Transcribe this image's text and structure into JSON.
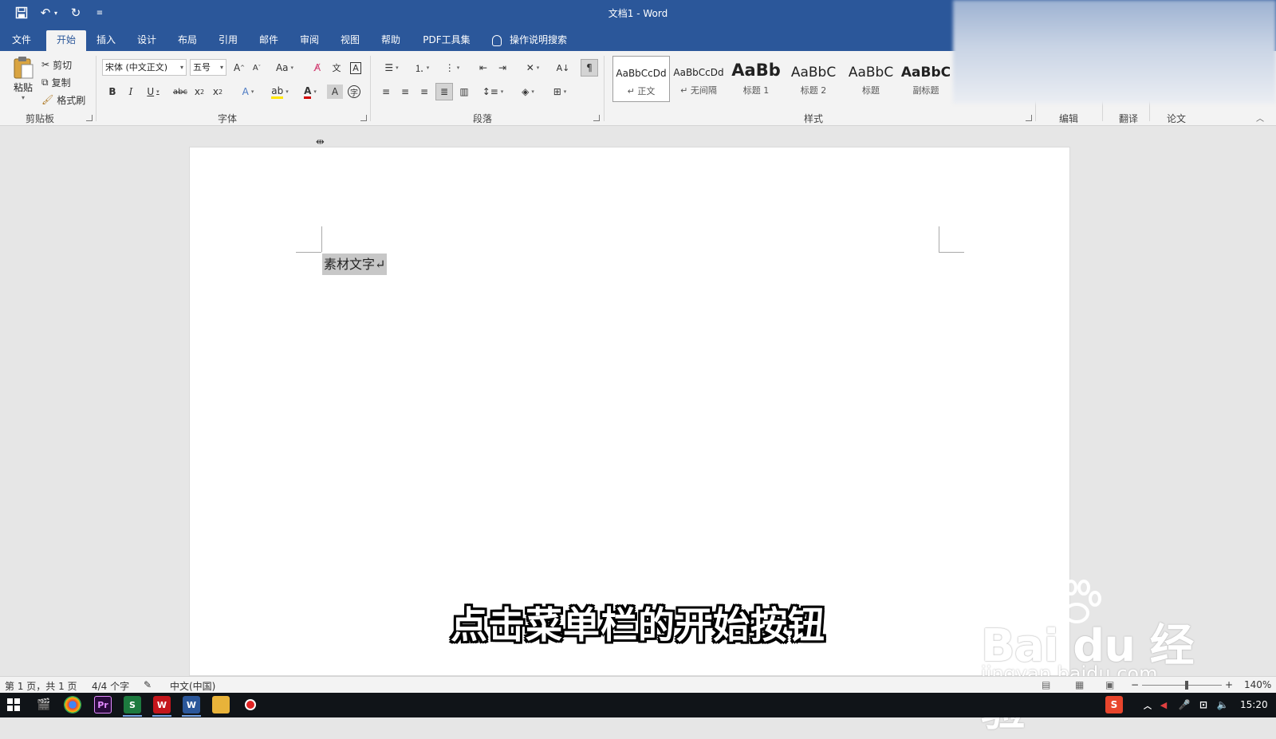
{
  "title_bar": {
    "document_title": "文档1  -  Word"
  },
  "menu": {
    "tabs": [
      "文件",
      "开始",
      "插入",
      "设计",
      "布局",
      "引用",
      "邮件",
      "审阅",
      "视图",
      "帮助",
      "PDF工具集"
    ],
    "active_tab": "开始",
    "tell_me": "操作说明搜索"
  },
  "ribbon": {
    "clipboard": {
      "label": "剪贴板",
      "paste": "粘贴",
      "cut": "剪切",
      "copy": "复制",
      "format_painter": "格式刷"
    },
    "font": {
      "label": "字体",
      "font_name": "宋体 (中文正文)",
      "font_size": "五号"
    },
    "paragraph": {
      "label": "段落"
    },
    "styles": {
      "label": "样式",
      "items": [
        {
          "sample": "AaBbCcDd",
          "name": "↵ 正文"
        },
        {
          "sample": "AaBbCcDd",
          "name": "↵ 无间隔"
        },
        {
          "sample": "AaBb",
          "name": "标题 1"
        },
        {
          "sample": "AaBbC",
          "name": "标题 2"
        },
        {
          "sample": "AaBbC",
          "name": "标题"
        },
        {
          "sample": "AaBbC",
          "name": "副标题"
        }
      ]
    },
    "edit": {
      "label": "编辑"
    },
    "translate": {
      "label": "翻译"
    },
    "paper": {
      "label": "论文"
    }
  },
  "document": {
    "selected_text": "素材文字↵"
  },
  "subtitle": "点击菜单栏的开始按钮",
  "watermark": {
    "brand": "Bai  du 经验",
    "url": "jingyan.baidu.com"
  },
  "status": {
    "page": "第 1 页，共 1 页",
    "words": "4/4 个字",
    "language": "中文(中国)",
    "zoom": "140%"
  },
  "taskbar": {
    "time": "15:20"
  },
  "colors": {
    "accent": "#2b579a",
    "ribbon_bg": "#f3f3f3",
    "font_color_red": "#d20000",
    "taskbar": "#101418"
  }
}
